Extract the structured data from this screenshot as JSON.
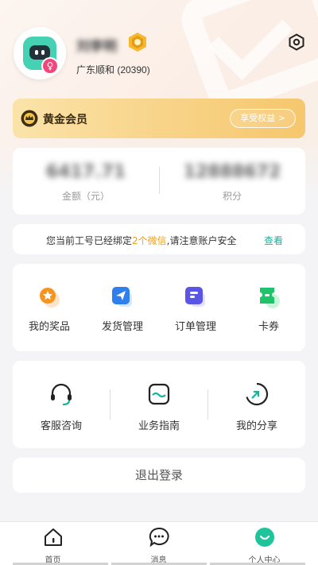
{
  "profile": {
    "username": "刘李明",
    "company": "广东顺和 (20390)",
    "gender_symbol": "♀"
  },
  "vip": {
    "title": "黄金会员",
    "button": "享受权益 >"
  },
  "stats": [
    {
      "value": "6417.71",
      "label": "金额（元）"
    },
    {
      "value": "12888672",
      "label": "积分"
    }
  ],
  "notice": {
    "prefix": "您当前工号已经绑定",
    "highlight": "2个微信",
    "suffix": ",请注意账户安全",
    "link": "查看"
  },
  "services": [
    {
      "label": "我的奖品",
      "icon": "prize-icon"
    },
    {
      "label": "发货管理",
      "icon": "paper-plane-icon"
    },
    {
      "label": "订单管理",
      "icon": "order-icon"
    },
    {
      "label": "卡券",
      "icon": "ticket-icon"
    }
  ],
  "tools": [
    {
      "label": "客服咨询",
      "icon": "headset-icon"
    },
    {
      "label": "业务指南",
      "icon": "guide-icon"
    },
    {
      "label": "我的分享",
      "icon": "share-icon"
    }
  ],
  "logout": "退出登录",
  "tabbar": [
    {
      "label": "首页",
      "icon": "home-icon"
    },
    {
      "label": "消息",
      "icon": "message-icon"
    },
    {
      "label": "个人中心",
      "icon": "smile-icon",
      "active": true
    }
  ],
  "colors": {
    "accent": "#14b39c",
    "highlight": "#f0a016",
    "vip_gold": "#f6c76d"
  }
}
